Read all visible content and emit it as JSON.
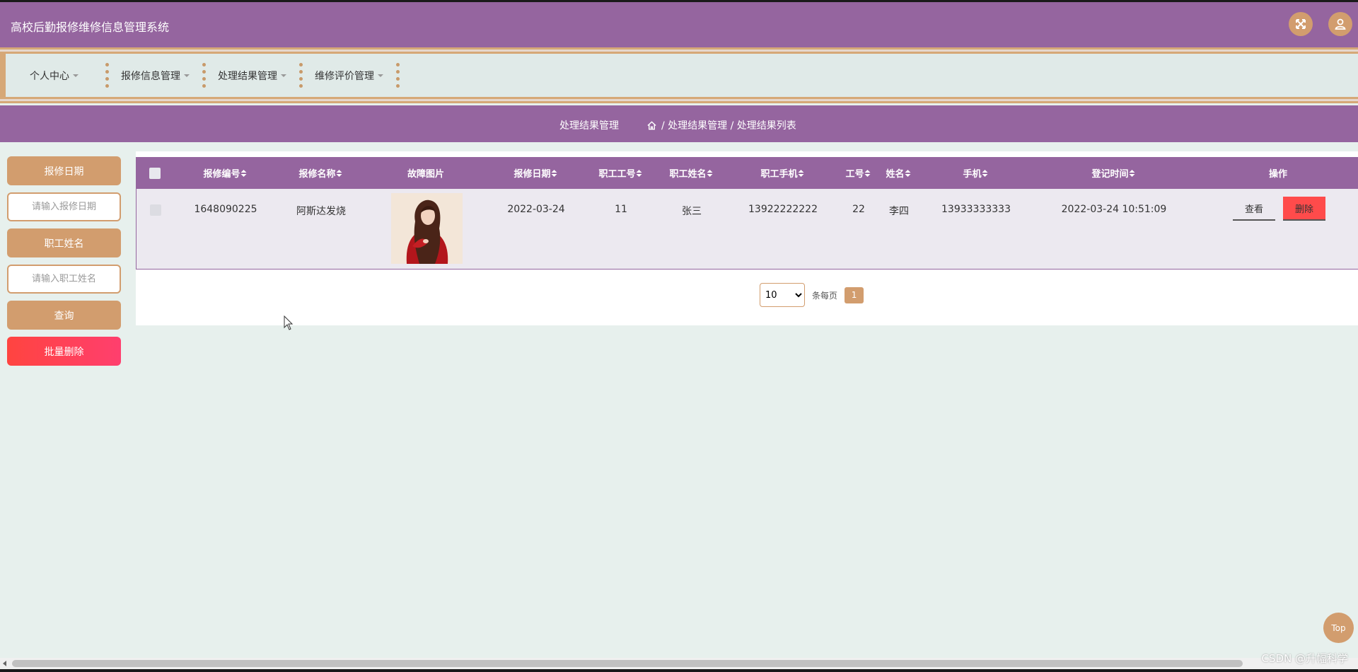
{
  "header": {
    "title": "高校后勤报修维修信息管理系统"
  },
  "nav": {
    "items": [
      {
        "label": "个人中心"
      },
      {
        "label": "报修信息管理"
      },
      {
        "label": "处理结果管理"
      },
      {
        "label": "维修评价管理"
      }
    ]
  },
  "breadcrumb": {
    "section": "处理结果管理",
    "path": "/ 处理结果管理 / 处理结果列表"
  },
  "sidebar": {
    "date_label": "报修日期",
    "date_placeholder": "请输入报修日期",
    "name_label": "职工姓名",
    "name_placeholder": "请输入职工姓名",
    "query_label": "查询",
    "batch_delete_label": "批量删除"
  },
  "table": {
    "headers": [
      "报修编号",
      "报修名称",
      "故障图片",
      "报修日期",
      "职工工号",
      "职工姓名",
      "职工手机",
      "工号",
      "姓名",
      "手机",
      "登记时间",
      "操作"
    ],
    "rows": [
      {
        "code": "1648090225",
        "name": "阿斯达发烧",
        "date": "2022-03-24",
        "staff_no": "11",
        "staff_name": "张三",
        "staff_phone": "13922222222",
        "worker_no": "22",
        "worker_name": "李四",
        "worker_phone": "13933333333",
        "created": "2022-03-24 10:51:09",
        "view_label": "查看",
        "delete_label": "删除"
      }
    ]
  },
  "pager": {
    "page_size": "10",
    "per_page_label": "条每页",
    "current_page": "1"
  },
  "top_button": "Top",
  "watermark": "CSDN @升幅科学"
}
